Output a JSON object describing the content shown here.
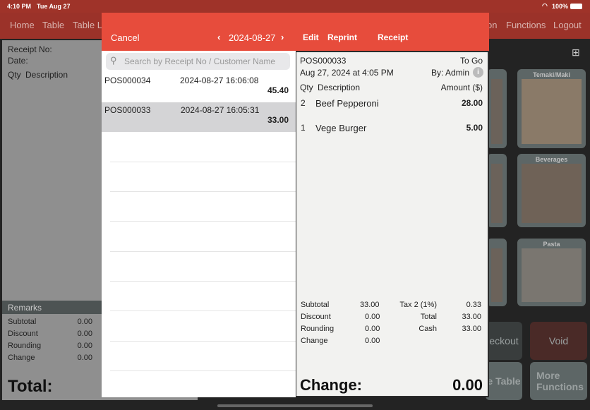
{
  "status": {
    "time": "4:10 PM",
    "date": "Tue Aug 27",
    "battery": "100%"
  },
  "nav": {
    "items": [
      "Home",
      "Table",
      "Table La",
      "on",
      "Functions",
      "Logout"
    ]
  },
  "left": {
    "receipt_no": "Receipt No:",
    "date": "Date:",
    "qty": "Qty",
    "description": "Description",
    "remarks": "Remarks",
    "rows": [
      {
        "label": "Subtotal",
        "value": "0.00"
      },
      {
        "label": "Discount",
        "value": "0.00"
      },
      {
        "label": "Rounding",
        "value": "0.00"
      },
      {
        "label": "Change",
        "value": "0.00"
      }
    ],
    "total": "Total:"
  },
  "tiles": [
    {
      "label": "Temaki/Maki"
    },
    {
      "label": "Beverages"
    },
    {
      "label": "Pasta"
    }
  ],
  "buttons": {
    "checkout": "eckout",
    "void": "Void",
    "table": "e Table",
    "more": "More Functions"
  },
  "colors": {
    "accent": "#e74c3c",
    "void": "#4a2a27"
  },
  "list": {
    "cancel": "Cancel",
    "date": "2024-08-27",
    "search_placeholder": "Search by Receipt No / Customer Name",
    "items": [
      {
        "no": "POS000034",
        "datetime": "2024-08-27 16:06:08",
        "amount": "45.40"
      },
      {
        "no": "POS000033",
        "datetime": "2024-08-27 16:05:31",
        "amount": "33.00",
        "selected": true
      }
    ]
  },
  "receipt": {
    "edit": "Edit",
    "reprint": "Reprint",
    "title": "Receipt",
    "no": "POS000033",
    "type": "To Go",
    "datetime": "Aug 27, 2024 at 4:05 PM",
    "by": "By: Admin",
    "qty_h": "Qty",
    "desc_h": "Description",
    "amt_h": "Amount ($)",
    "items": [
      {
        "qty": "2",
        "desc": "Beef Pepperoni",
        "amount": "28.00"
      },
      {
        "qty": "1",
        "desc": "Vege Burger",
        "amount": "5.00"
      }
    ],
    "left_rows": [
      {
        "label": "Subtotal",
        "value": "33.00"
      },
      {
        "label": "Discount",
        "value": "0.00"
      },
      {
        "label": "Rounding",
        "value": "0.00"
      },
      {
        "label": "Change",
        "value": "0.00"
      }
    ],
    "right_rows": [
      {
        "label": "Tax 2 (1%)",
        "value": "0.33"
      },
      {
        "label": "Total",
        "value": "33.00"
      },
      {
        "label": "Cash",
        "value": "33.00"
      }
    ],
    "change_label": "Change:",
    "change_value": "0.00"
  }
}
